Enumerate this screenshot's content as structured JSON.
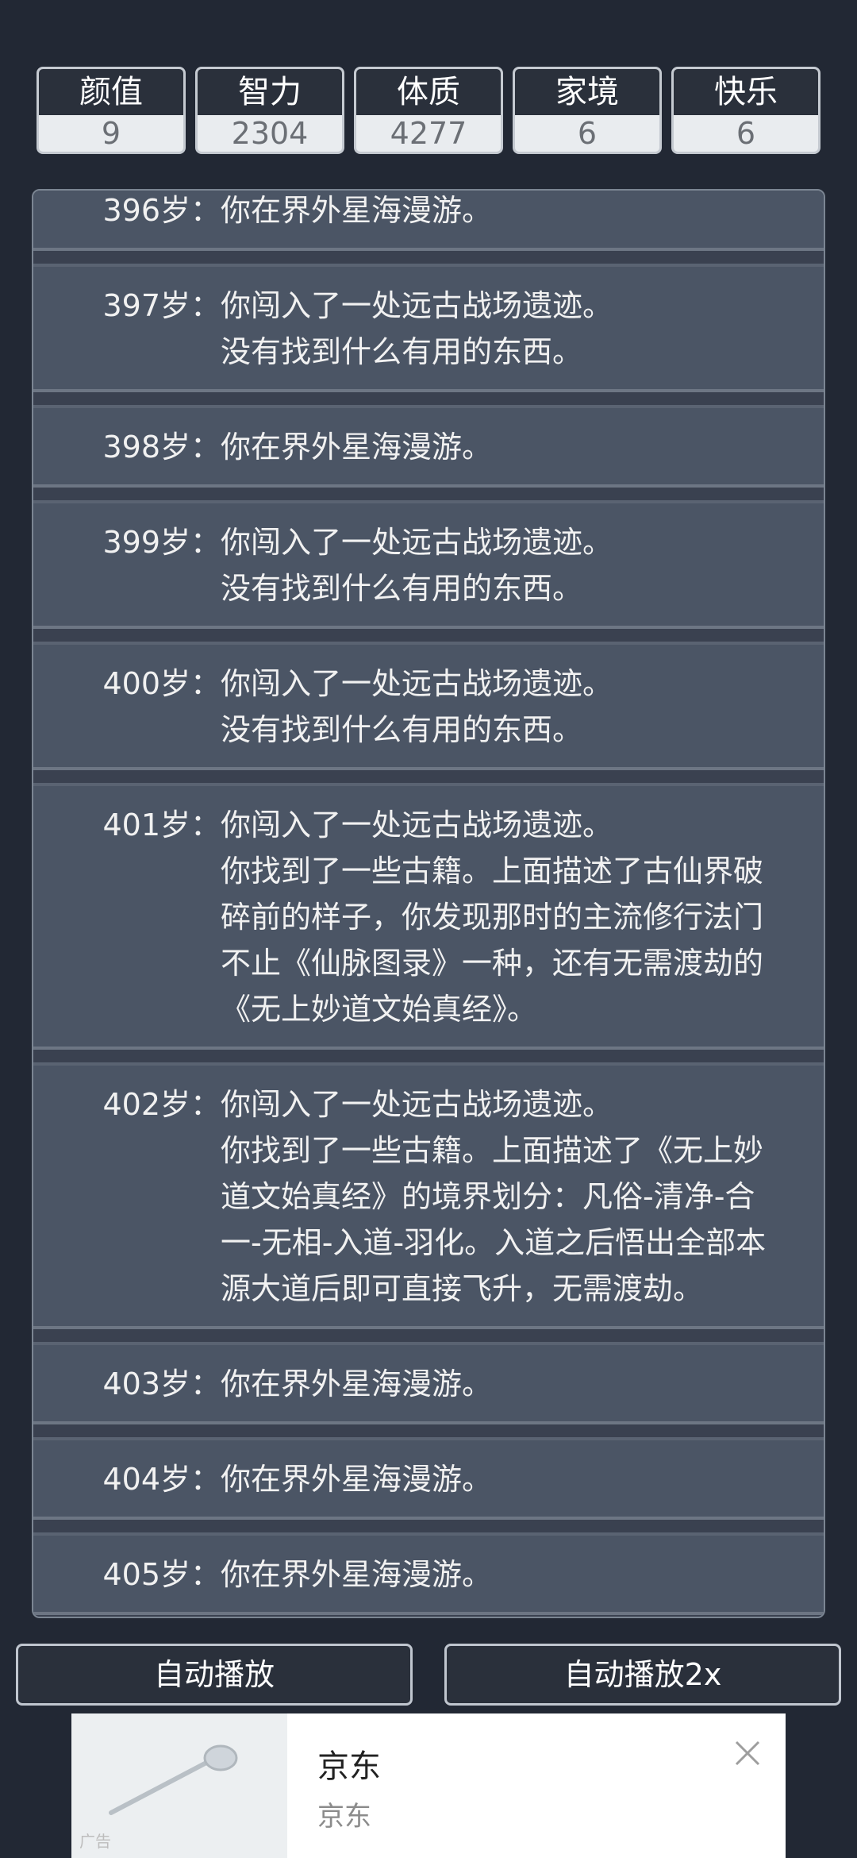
{
  "stats": [
    {
      "label": "颜值",
      "value": "9"
    },
    {
      "label": "智力",
      "value": "2304"
    },
    {
      "label": "体质",
      "value": "4277"
    },
    {
      "label": "家境",
      "value": "6"
    },
    {
      "label": "快乐",
      "value": "6"
    }
  ],
  "log": [
    {
      "age": "396岁：",
      "lines": [
        "你在界外星海漫游。"
      ]
    },
    {
      "age": "397岁：",
      "lines": [
        "你闯入了一处远古战场遗迹。",
        "没有找到什么有用的东西。"
      ]
    },
    {
      "age": "398岁：",
      "lines": [
        "你在界外星海漫游。"
      ]
    },
    {
      "age": "399岁：",
      "lines": [
        "你闯入了一处远古战场遗迹。",
        "没有找到什么有用的东西。"
      ]
    },
    {
      "age": "400岁：",
      "lines": [
        "你闯入了一处远古战场遗迹。",
        "没有找到什么有用的东西。"
      ]
    },
    {
      "age": "401岁：",
      "lines": [
        "你闯入了一处远古战场遗迹。",
        "你找到了一些古籍。上面描述了古仙界破",
        "碎前的样子，你发现那时的主流修行法门",
        "不止《仙脉图录》一种，还有无需渡劫的",
        "《无上妙道文始真经》。"
      ]
    },
    {
      "age": "402岁：",
      "lines": [
        "你闯入了一处远古战场遗迹。",
        "你找到了一些古籍。上面描述了《无上妙",
        "道文始真经》的境界划分：凡俗-清净-合",
        "一-无相-入道-羽化。入道之后悟出全部本",
        "源大道后即可直接飞升，无需渡劫。"
      ]
    },
    {
      "age": "403岁：",
      "lines": [
        "你在界外星海漫游。"
      ]
    },
    {
      "age": "404岁：",
      "lines": [
        "你在界外星海漫游。"
      ]
    },
    {
      "age": "405岁：",
      "lines": [
        "你在界外星海漫游。"
      ]
    }
  ],
  "buttons": {
    "auto_play": "自动播放",
    "auto_play_2x": "自动播放2x"
  },
  "ad": {
    "title": "京东",
    "subtitle": "京东",
    "tag": "广告",
    "image_icon": "spoon-icon",
    "close_icon": "close-icon"
  }
}
